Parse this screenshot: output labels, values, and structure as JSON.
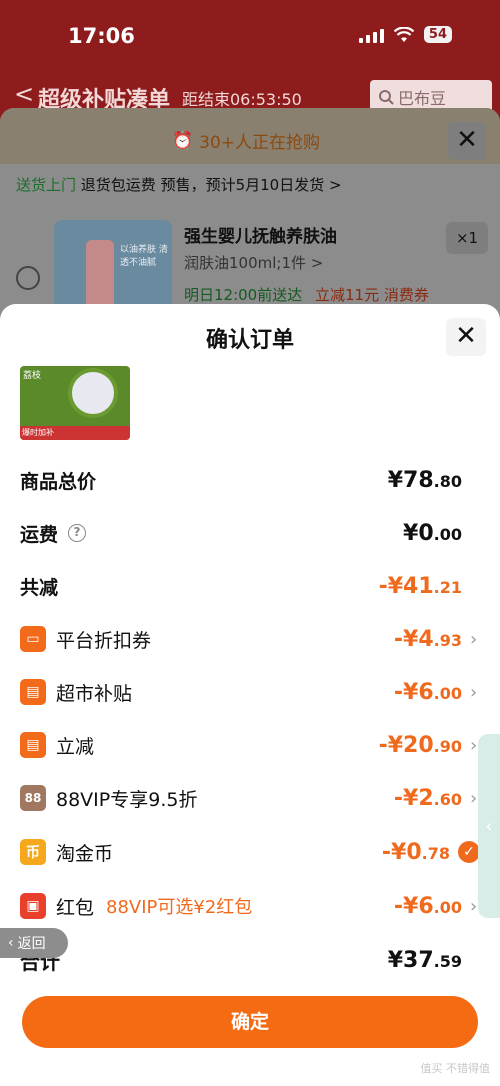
{
  "status": {
    "time": "17:06",
    "battery": "54"
  },
  "header": {
    "back": "<",
    "title": "超级补贴凑单",
    "timer": "距结束06:53:50",
    "search_placeholder": "巴布豆"
  },
  "background_panel": {
    "grab_text": "30+人正在抢购",
    "delivery": {
      "green": "送货上门",
      "rest": "退货包运费 预售，预计5月10日发货 >"
    },
    "product": {
      "name": "强生婴儿抚触养肤油",
      "qty": "×1",
      "spec": "润肤油100ml;1件 >",
      "delivery_time": "明日12:00前送达",
      "discount_text": "立减11元 消费券",
      "image_text": "以油养肤 清透不油腻"
    }
  },
  "sheet": {
    "title": "确认订单",
    "image_labels": [
      "荔枝",
      "爆时加补"
    ],
    "rows": {
      "subtotal": {
        "label": "商品总价",
        "int": "¥78",
        "dec": ".80"
      },
      "shipping": {
        "label": "运费",
        "int": "¥0",
        "dec": ".00"
      },
      "total_discount": {
        "label": "共减",
        "int": "-¥41",
        "dec": ".21"
      },
      "platform_coupon": {
        "label": "平台折扣券",
        "int": "-¥4",
        "dec": ".93"
      },
      "market_subsidy": {
        "label": "超市补贴",
        "int": "-¥6",
        "dec": ".00"
      },
      "instant_discount": {
        "label": "立减",
        "int": "-¥20",
        "dec": ".90"
      },
      "vip": {
        "label": "88VIP专享9.5折",
        "icon_text": "88",
        "int": "-¥2",
        "dec": ".60"
      },
      "coin": {
        "label": "淘金币",
        "icon_text": "币",
        "int": "-¥0",
        "dec": ".78"
      },
      "red_packet": {
        "label": "红包",
        "promo": "88VIP可选¥2红包",
        "int": "-¥6",
        "dec": ".00"
      },
      "total": {
        "label": "合计",
        "int": "¥37",
        "dec": ".59"
      }
    },
    "return_label": "返回",
    "confirm_label": "确定",
    "watermark": "值买 不错得值"
  },
  "colors": {
    "accent": "#f56b13",
    "price_orange": "#f06a1e",
    "header_red": "#8e1c1c"
  }
}
